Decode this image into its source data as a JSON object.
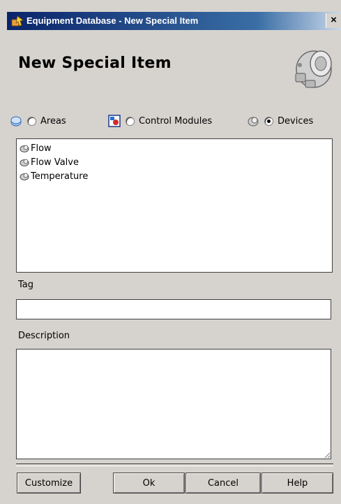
{
  "window": {
    "title": "Equipment Database - New Special Item",
    "close_label": "×"
  },
  "dialog": {
    "heading": "New Special Item"
  },
  "type_selector": {
    "options": [
      {
        "label": "Areas",
        "icon": "areas-icon",
        "checked": false
      },
      {
        "label": "Control Modules",
        "icon": "control-modules-icon",
        "checked": false
      },
      {
        "label": "Devices",
        "icon": "devices-icon",
        "checked": true
      }
    ]
  },
  "item_list": {
    "items": [
      {
        "label": "Flow",
        "icon": "device-icon"
      },
      {
        "label": "Flow Valve",
        "icon": "device-icon"
      },
      {
        "label": "Temperature",
        "icon": "device-icon"
      }
    ]
  },
  "form": {
    "tag_label": "Tag",
    "tag_value": "",
    "description_label": "Description",
    "description_value": ""
  },
  "buttons": {
    "customize": "Customize",
    "ok": "Ok",
    "cancel": "Cancel",
    "help": "Help"
  },
  "colors": {
    "background": "#d6d3ce",
    "titlebar_start": "#0a246a",
    "titlebar_end": "#c9d7ea"
  }
}
